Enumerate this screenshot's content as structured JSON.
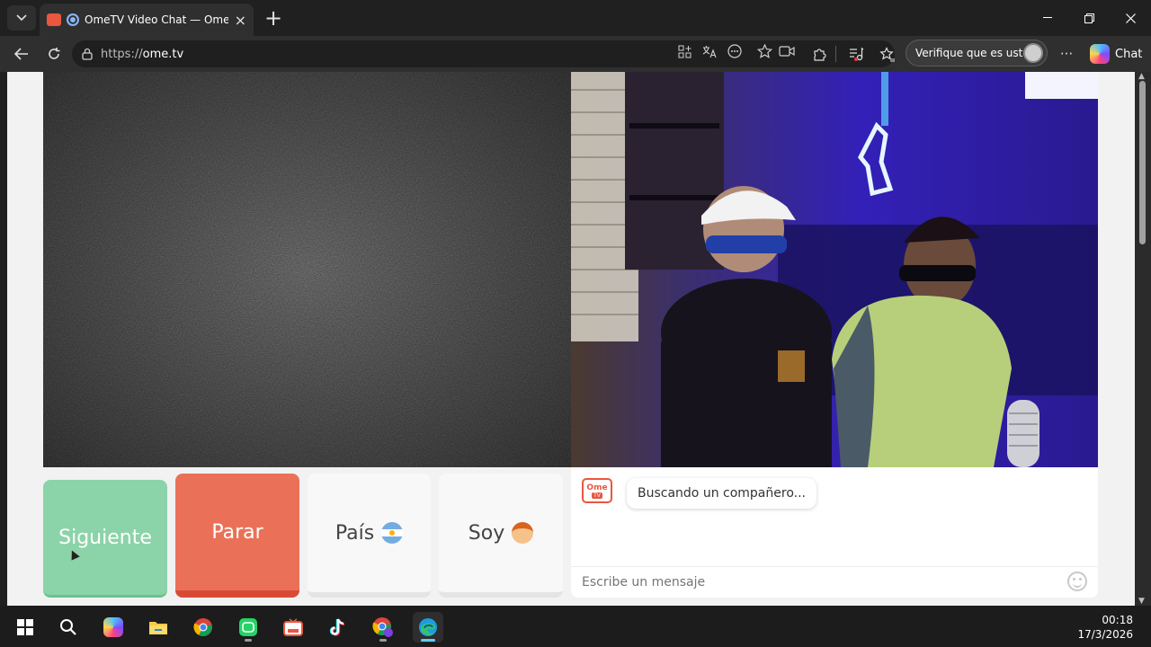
{
  "browser": {
    "tab": {
      "title": "OmeTV Video Chat — Omegl",
      "close_icon": "×"
    },
    "new_tab_icon": "+",
    "url": {
      "scheme": "https://",
      "host": "ome.tv"
    },
    "profile_pill": {
      "label": "Verifique que es usted"
    },
    "chat_button": {
      "label": "Chat"
    },
    "more_icon": "···"
  },
  "page": {
    "buttons": {
      "next": "Siguiente",
      "stop": "Parar",
      "country": "País",
      "gender": "Soy"
    },
    "chat": {
      "logo_top": "Ome",
      "logo_bottom": "TV",
      "status_message": "Buscando un compañero...",
      "input_placeholder": "Escribe un mensaje"
    },
    "colors": {
      "next_button": "#8bd3a8",
      "stop_button": "#ea7158",
      "brand": "#e9573f"
    }
  },
  "taskbar": {
    "apps": [
      "windows-start",
      "search",
      "copilot",
      "file-explorer",
      "chrome",
      "whatsapp",
      "ometv",
      "tiktok",
      "chrome-profile",
      "edge"
    ],
    "clock": {
      "time": "00:18",
      "date": "17/3/2026"
    }
  }
}
